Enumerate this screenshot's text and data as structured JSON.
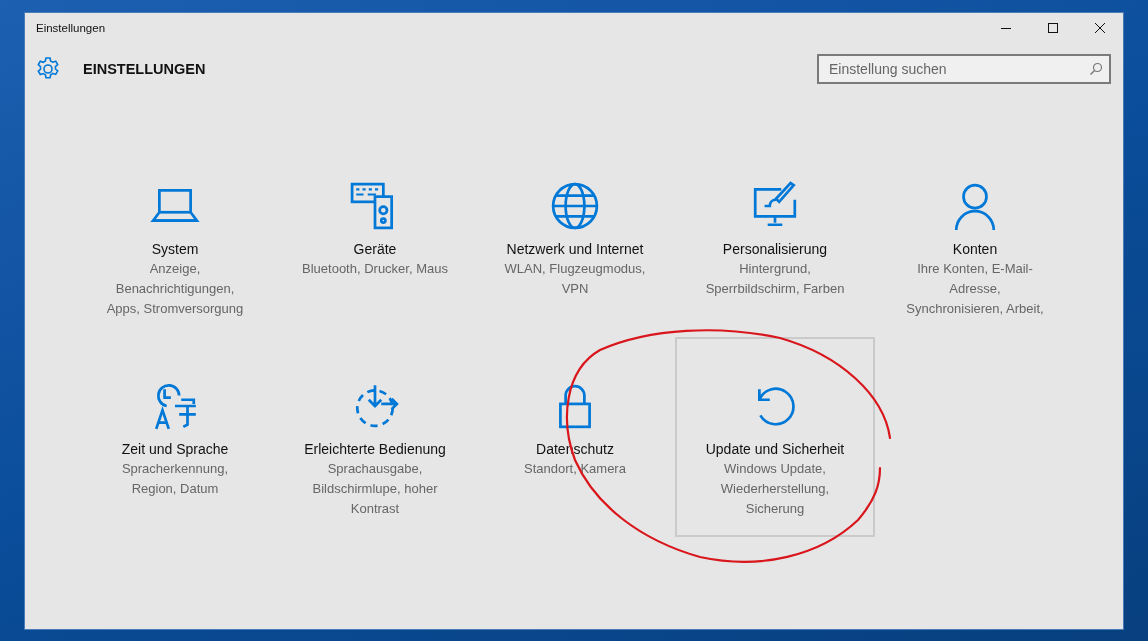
{
  "window": {
    "title": "Einstellungen"
  },
  "header": {
    "title": "EINSTELLUNGEN"
  },
  "search": {
    "placeholder": "Einstellung suchen"
  },
  "categories": [
    {
      "title": "System",
      "description": "Anzeige, Benachrichtigungen, Apps, Stromversorgung",
      "selected": false
    },
    {
      "title": "Geräte",
      "description": "Bluetooth, Drucker, Maus",
      "selected": false
    },
    {
      "title": "Netzwerk und Internet",
      "description": "WLAN, Flugzeugmodus, VPN",
      "selected": false
    },
    {
      "title": "Personalisierung",
      "description": "Hintergrund, Sperrbildschirm, Farben",
      "selected": false
    },
    {
      "title": "Konten",
      "description": "Ihre Konten, E-Mail-Adresse, Synchronisieren, Arbeit,",
      "selected": false
    },
    {
      "title": "Zeit und Sprache",
      "description": "Spracherkennung, Region, Datum",
      "selected": false
    },
    {
      "title": "Erleichterte Bedienung",
      "description": "Sprachausgabe, Bildschirmlupe, hoher Kontrast",
      "selected": false
    },
    {
      "title": "Datenschutz",
      "description": "Standort, Kamera",
      "selected": false
    },
    {
      "title": "Update und Sicherheit",
      "description": "Windows Update, Wiederherstellung, Sicherung",
      "selected": true
    }
  ]
}
